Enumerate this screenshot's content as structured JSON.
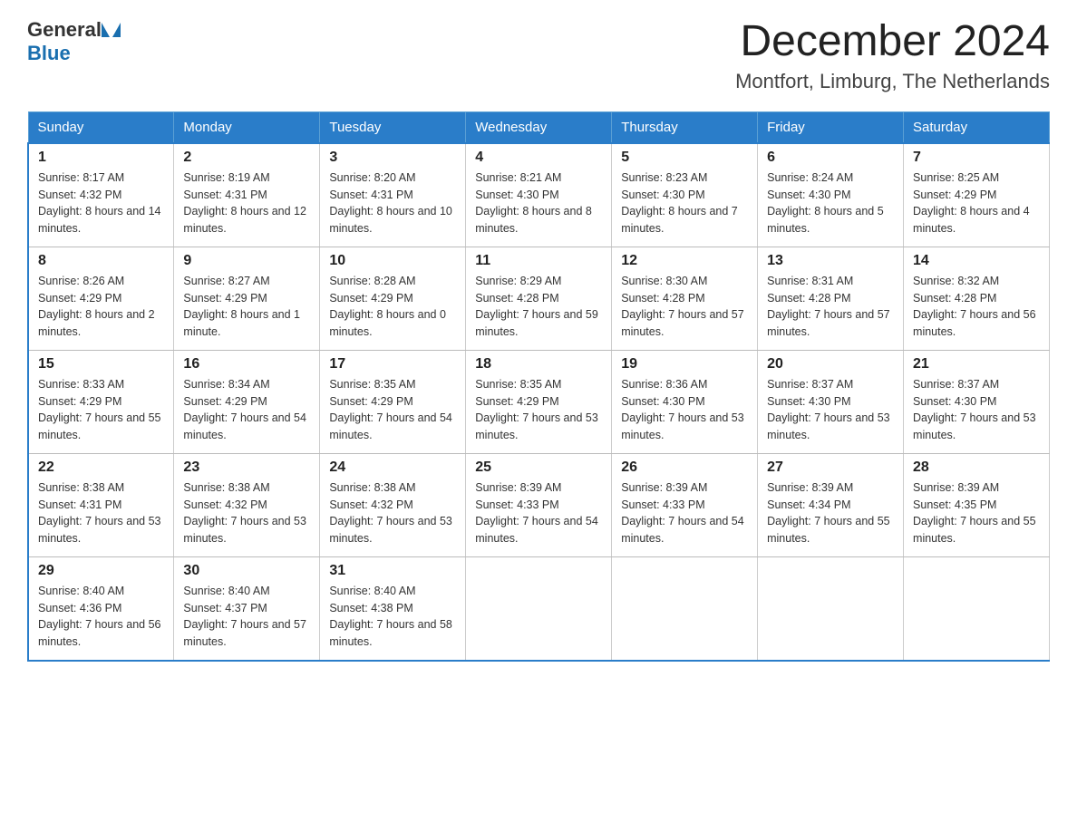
{
  "header": {
    "logo_general": "General",
    "logo_blue": "Blue",
    "month_title": "December 2024",
    "location": "Montfort, Limburg, The Netherlands"
  },
  "calendar": {
    "days_of_week": [
      "Sunday",
      "Monday",
      "Tuesday",
      "Wednesday",
      "Thursday",
      "Friday",
      "Saturday"
    ],
    "weeks": [
      [
        {
          "day": "1",
          "sunrise": "8:17 AM",
          "sunset": "4:32 PM",
          "daylight": "8 hours and 14 minutes."
        },
        {
          "day": "2",
          "sunrise": "8:19 AM",
          "sunset": "4:31 PM",
          "daylight": "8 hours and 12 minutes."
        },
        {
          "day": "3",
          "sunrise": "8:20 AM",
          "sunset": "4:31 PM",
          "daylight": "8 hours and 10 minutes."
        },
        {
          "day": "4",
          "sunrise": "8:21 AM",
          "sunset": "4:30 PM",
          "daylight": "8 hours and 8 minutes."
        },
        {
          "day": "5",
          "sunrise": "8:23 AM",
          "sunset": "4:30 PM",
          "daylight": "8 hours and 7 minutes."
        },
        {
          "day": "6",
          "sunrise": "8:24 AM",
          "sunset": "4:30 PM",
          "daylight": "8 hours and 5 minutes."
        },
        {
          "day": "7",
          "sunrise": "8:25 AM",
          "sunset": "4:29 PM",
          "daylight": "8 hours and 4 minutes."
        }
      ],
      [
        {
          "day": "8",
          "sunrise": "8:26 AM",
          "sunset": "4:29 PM",
          "daylight": "8 hours and 2 minutes."
        },
        {
          "day": "9",
          "sunrise": "8:27 AM",
          "sunset": "4:29 PM",
          "daylight": "8 hours and 1 minute."
        },
        {
          "day": "10",
          "sunrise": "8:28 AM",
          "sunset": "4:29 PM",
          "daylight": "8 hours and 0 minutes."
        },
        {
          "day": "11",
          "sunrise": "8:29 AM",
          "sunset": "4:28 PM",
          "daylight": "7 hours and 59 minutes."
        },
        {
          "day": "12",
          "sunrise": "8:30 AM",
          "sunset": "4:28 PM",
          "daylight": "7 hours and 57 minutes."
        },
        {
          "day": "13",
          "sunrise": "8:31 AM",
          "sunset": "4:28 PM",
          "daylight": "7 hours and 57 minutes."
        },
        {
          "day": "14",
          "sunrise": "8:32 AM",
          "sunset": "4:28 PM",
          "daylight": "7 hours and 56 minutes."
        }
      ],
      [
        {
          "day": "15",
          "sunrise": "8:33 AM",
          "sunset": "4:29 PM",
          "daylight": "7 hours and 55 minutes."
        },
        {
          "day": "16",
          "sunrise": "8:34 AM",
          "sunset": "4:29 PM",
          "daylight": "7 hours and 54 minutes."
        },
        {
          "day": "17",
          "sunrise": "8:35 AM",
          "sunset": "4:29 PM",
          "daylight": "7 hours and 54 minutes."
        },
        {
          "day": "18",
          "sunrise": "8:35 AM",
          "sunset": "4:29 PM",
          "daylight": "7 hours and 53 minutes."
        },
        {
          "day": "19",
          "sunrise": "8:36 AM",
          "sunset": "4:30 PM",
          "daylight": "7 hours and 53 minutes."
        },
        {
          "day": "20",
          "sunrise": "8:37 AM",
          "sunset": "4:30 PM",
          "daylight": "7 hours and 53 minutes."
        },
        {
          "day": "21",
          "sunrise": "8:37 AM",
          "sunset": "4:30 PM",
          "daylight": "7 hours and 53 minutes."
        }
      ],
      [
        {
          "day": "22",
          "sunrise": "8:38 AM",
          "sunset": "4:31 PM",
          "daylight": "7 hours and 53 minutes."
        },
        {
          "day": "23",
          "sunrise": "8:38 AM",
          "sunset": "4:32 PM",
          "daylight": "7 hours and 53 minutes."
        },
        {
          "day": "24",
          "sunrise": "8:38 AM",
          "sunset": "4:32 PM",
          "daylight": "7 hours and 53 minutes."
        },
        {
          "day": "25",
          "sunrise": "8:39 AM",
          "sunset": "4:33 PM",
          "daylight": "7 hours and 54 minutes."
        },
        {
          "day": "26",
          "sunrise": "8:39 AM",
          "sunset": "4:33 PM",
          "daylight": "7 hours and 54 minutes."
        },
        {
          "day": "27",
          "sunrise": "8:39 AM",
          "sunset": "4:34 PM",
          "daylight": "7 hours and 55 minutes."
        },
        {
          "day": "28",
          "sunrise": "8:39 AM",
          "sunset": "4:35 PM",
          "daylight": "7 hours and 55 minutes."
        }
      ],
      [
        {
          "day": "29",
          "sunrise": "8:40 AM",
          "sunset": "4:36 PM",
          "daylight": "7 hours and 56 minutes."
        },
        {
          "day": "30",
          "sunrise": "8:40 AM",
          "sunset": "4:37 PM",
          "daylight": "7 hours and 57 minutes."
        },
        {
          "day": "31",
          "sunrise": "8:40 AM",
          "sunset": "4:38 PM",
          "daylight": "7 hours and 58 minutes."
        },
        null,
        null,
        null,
        null
      ]
    ],
    "labels": {
      "sunrise": "Sunrise:",
      "sunset": "Sunset:",
      "daylight": "Daylight:"
    }
  }
}
